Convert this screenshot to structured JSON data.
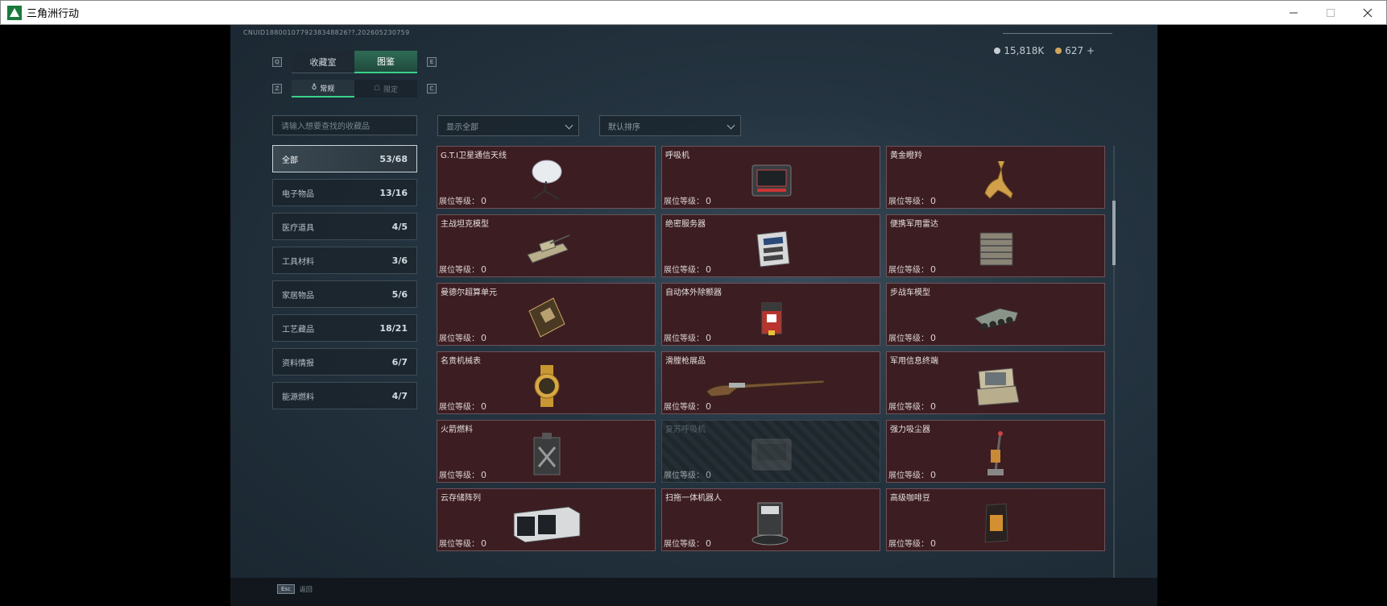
{
  "window": {
    "title": "三角洲行动"
  },
  "header": {
    "uid": "CNUID1880010779238348826??,202605230759",
    "currency": [
      {
        "value": "15,818K",
        "color": "#c8ced2"
      },
      {
        "value": "627 +",
        "color": "#d2a65a"
      }
    ],
    "keyhints": {
      "q": "Q",
      "e": "E",
      "z": "Z",
      "c": "C"
    }
  },
  "tabs": [
    {
      "label": "收藏室",
      "active": false
    },
    {
      "label": "图鉴",
      "active": true
    }
  ],
  "subtabs": [
    {
      "label": "常规",
      "active": true
    },
    {
      "label": "限定",
      "active": false
    }
  ],
  "filters": {
    "search_placeholder": "请输入想要查找的收藏品",
    "show": "显示全部",
    "sort": "默认排序"
  },
  "categories": [
    {
      "name": "全部",
      "count": "53/68",
      "active": true
    },
    {
      "name": "电子物品",
      "count": "13/16",
      "active": false
    },
    {
      "name": "医疗道具",
      "count": "4/5",
      "active": false
    },
    {
      "name": "工具材料",
      "count": "3/6",
      "active": false
    },
    {
      "name": "家居物品",
      "count": "5/6",
      "active": false
    },
    {
      "name": "工艺藏品",
      "count": "18/21",
      "active": false
    },
    {
      "name": "资料情报",
      "count": "6/7",
      "active": false
    },
    {
      "name": "能源燃料",
      "count": "4/7",
      "active": false
    }
  ],
  "level_label": "展位等级：",
  "items": [
    {
      "name": "G.T.I卫星通信天线",
      "level": "0",
      "icon": "satellite-dish-icon",
      "locked": false
    },
    {
      "name": "呼吸机",
      "level": "0",
      "icon": "ventilator-icon",
      "locked": false
    },
    {
      "name": "黄金瞪羚",
      "level": "0",
      "icon": "golden-gazelle-icon",
      "locked": false
    },
    {
      "name": "主战坦克模型",
      "level": "0",
      "icon": "tank-model-icon",
      "locked": false
    },
    {
      "name": "绝密服务器",
      "level": "0",
      "icon": "server-icon",
      "locked": false
    },
    {
      "name": "便携军用雷达",
      "level": "0",
      "icon": "radar-icon",
      "locked": false
    },
    {
      "name": "曼德尔超算单元",
      "level": "0",
      "icon": "supercomputer-unit-icon",
      "locked": false
    },
    {
      "name": "自动体外除颤器",
      "level": "0",
      "icon": "defibrillator-icon",
      "locked": false
    },
    {
      "name": "步战车模型",
      "level": "0",
      "icon": "ifv-model-icon",
      "locked": false
    },
    {
      "name": "名贵机械表",
      "level": "0",
      "icon": "watch-icon",
      "locked": false
    },
    {
      "name": "滑膛枪展品",
      "level": "0",
      "icon": "musket-icon",
      "locked": false
    },
    {
      "name": "军用信息终端",
      "level": "0",
      "icon": "military-terminal-icon",
      "locked": false
    },
    {
      "name": "火箭燃料",
      "level": "0",
      "icon": "rocket-fuel-icon",
      "locked": false
    },
    {
      "name": "复苏呼吸机",
      "level": "0",
      "icon": "resuscitator-icon",
      "locked": true
    },
    {
      "name": "强力吸尘器",
      "level": "0",
      "icon": "vacuum-cleaner-icon",
      "locked": false
    },
    {
      "name": "云存储阵列",
      "level": "0",
      "icon": "storage-array-icon",
      "locked": false
    },
    {
      "name": "扫拖一体机器人",
      "level": "0",
      "icon": "robot-vacuum-icon",
      "locked": false
    },
    {
      "name": "高级咖啡豆",
      "level": "0",
      "icon": "coffee-beans-icon",
      "locked": false
    }
  ],
  "footer": {
    "key": "Esc",
    "label": "返回"
  }
}
